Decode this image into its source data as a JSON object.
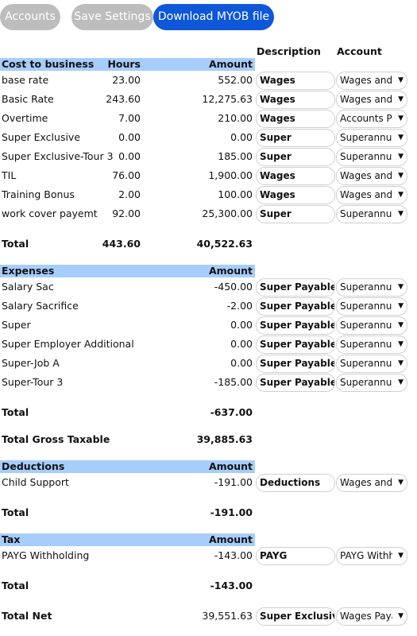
{
  "toolbar": {
    "accounts_label": "Accounts",
    "save_label": "Save Settings",
    "download_label": "Download MYOB file"
  },
  "columns": {
    "description": "Description",
    "account": "Account"
  },
  "colors": {
    "header_bg": "#a6cdfb",
    "primary": "#0d57d8",
    "disabled": "#bdbdbd"
  },
  "cost": {
    "header": {
      "label": "Cost to business",
      "hours": "Hours",
      "amount": "Amount"
    },
    "rows": [
      {
        "label": "base rate",
        "hours": "23.00",
        "amount": "552.00",
        "desc": "Wages",
        "account": "Wages and"
      },
      {
        "label": "Basic Rate",
        "hours": "243.60",
        "amount": "12,275.63",
        "desc": "Wages",
        "account": "Wages and"
      },
      {
        "label": "Overtime",
        "hours": "7.00",
        "amount": "210.00",
        "desc": "Wages",
        "account": "Accounts Pa"
      },
      {
        "label": "Super Exclusive",
        "hours": "0.00",
        "amount": "0.00",
        "desc": "Super",
        "account": "Superannua"
      },
      {
        "label": "Super Exclusive-Tour 3",
        "hours": "0.00",
        "amount": "185.00",
        "desc": "Super",
        "account": "Superannua"
      },
      {
        "label": "TIL",
        "hours": "76.00",
        "amount": "1,900.00",
        "desc": "Wages",
        "account": "Wages and"
      },
      {
        "label": "Training Bonus",
        "hours": "2.00",
        "amount": "100.00",
        "desc": "Wages",
        "account": "Wages and"
      },
      {
        "label": "work cover payemt",
        "hours": "92.00",
        "amount": "25,300.00",
        "desc": "Super",
        "account": "Superannua"
      }
    ],
    "total": {
      "label": "Total",
      "hours": "443.60",
      "amount": "40,522.63"
    }
  },
  "expenses": {
    "header": {
      "label": "Expenses",
      "amount": "Amount"
    },
    "rows": [
      {
        "label": "Salary Sac",
        "amount": "-450.00",
        "desc": "Super Payable",
        "account": "Superannua"
      },
      {
        "label": "Salary Sacrifice",
        "amount": "-2.00",
        "desc": "Super Payable",
        "account": "Superannua"
      },
      {
        "label": "Super",
        "amount": "0.00",
        "desc": "Super Payable",
        "account": "Superannua"
      },
      {
        "label": "Super Employer Additional",
        "amount": "0.00",
        "desc": "Super Payable",
        "account": "Superannua"
      },
      {
        "label": "Super-Job A",
        "amount": "0.00",
        "desc": "Super Payable",
        "account": "Superannua"
      },
      {
        "label": "Super-Tour 3",
        "amount": "-185.00",
        "desc": "Super Payable",
        "account": "Superannua"
      }
    ],
    "total": {
      "label": "Total",
      "amount": "-637.00"
    }
  },
  "gross_taxable": {
    "label": "Total Gross Taxable",
    "amount": "39,885.63"
  },
  "deductions": {
    "header": {
      "label": "Deductions",
      "amount": "Amount"
    },
    "rows": [
      {
        "label": "Child Support",
        "amount": "-191.00",
        "desc": "Deductions",
        "account": "Wages and"
      }
    ],
    "total": {
      "label": "Total",
      "amount": "-191.00"
    }
  },
  "tax": {
    "header": {
      "label": "Tax",
      "amount": "Amount"
    },
    "rows": [
      {
        "label": "PAYG Withholding",
        "amount": "-143.00",
        "desc": "PAYG",
        "account": "PAYG Withh"
      }
    ],
    "total": {
      "label": "Total",
      "amount": "-143.00"
    }
  },
  "net": {
    "label": "Total Net",
    "amount": "39,551.63",
    "desc": "Super Exclusive",
    "account": "Wages Paya"
  },
  "icons": {
    "dropdown": "▼"
  }
}
